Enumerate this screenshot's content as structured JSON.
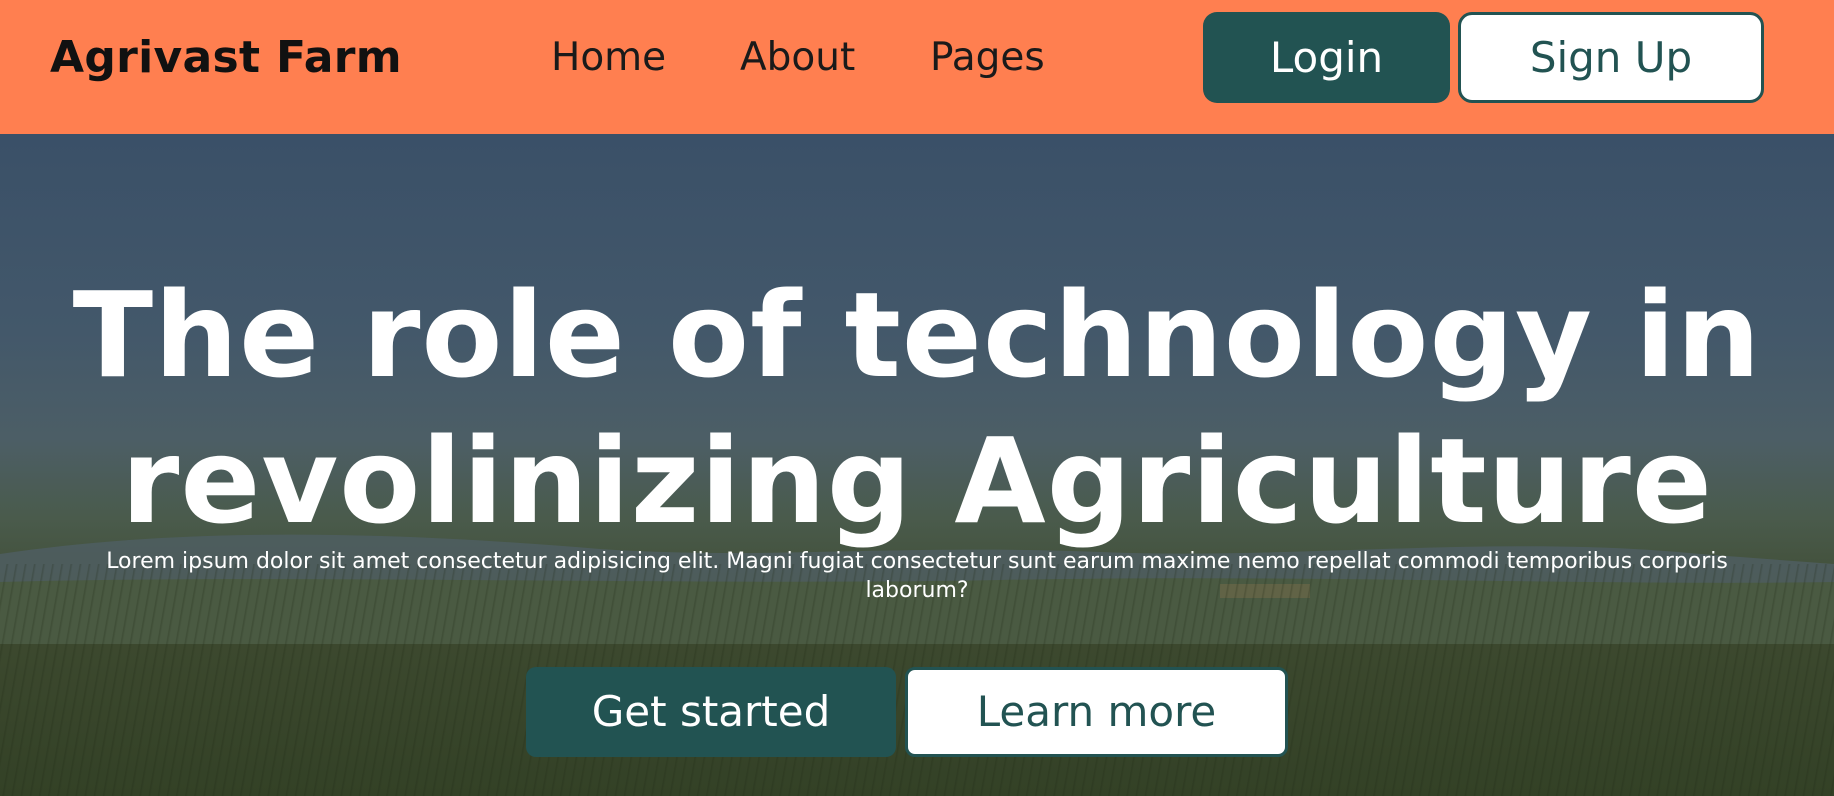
{
  "navbar": {
    "brand": "Agrivast Farm",
    "links": [
      "Home",
      "About",
      "Pages"
    ],
    "login_label": "Login",
    "signup_label": "Sign Up",
    "background_color": "#ff7f50",
    "button_color": "#225352"
  },
  "hero": {
    "title_lines": [
      "The role of technology in",
      "revolinizing Agriculture"
    ],
    "subtitle_lines": [
      "Lorem ipsum dolor sit amet consectetur adipisicing elit. Magni fugiat consectetur sunt earum maxime nemo repellat commodi temporibus corporis",
      "laborum?"
    ],
    "primary_button": "Get started",
    "secondary_button": "Learn more",
    "background_image": "farm-field-landscape"
  }
}
